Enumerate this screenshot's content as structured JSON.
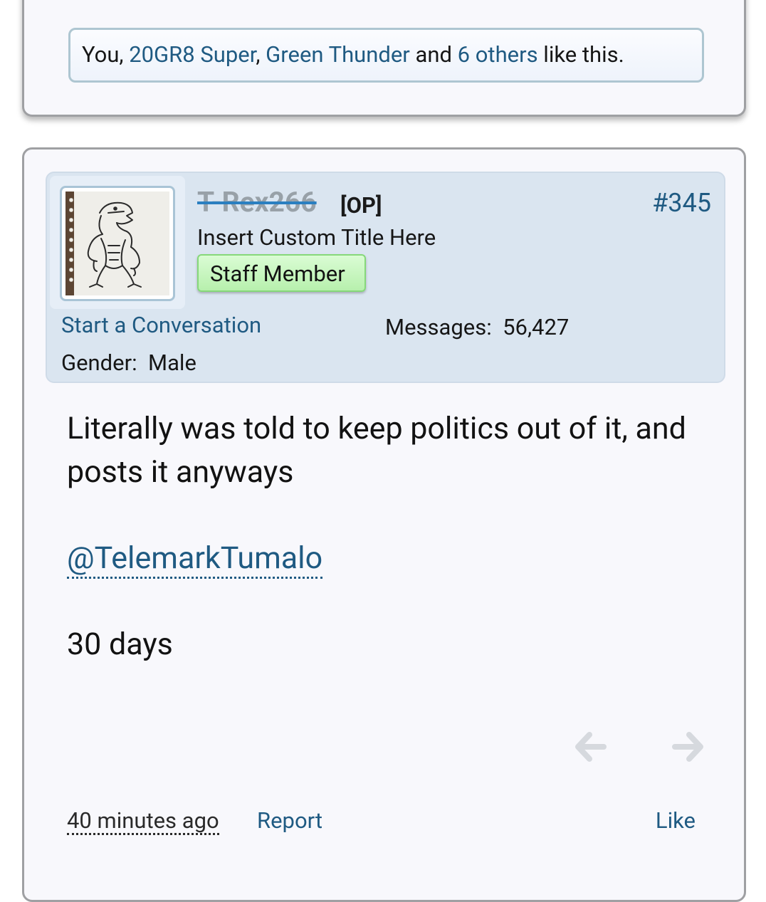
{
  "previous_post": {
    "likes": {
      "you": "You",
      "sep1": ", ",
      "user1": "20GR8 Super",
      "sep2": ", ",
      "user2": "Green Thunder",
      "and": " and ",
      "others": "6 others",
      "suffix": " like this."
    }
  },
  "post": {
    "username": "T-Rex266",
    "op_tag": "[OP]",
    "post_number": "#345",
    "user_title": "Insert Custom Title Here",
    "badge": "Staff Member",
    "start_conversation": "Start a Conversation",
    "messages_label": "Messages:",
    "messages_value": "56,427",
    "gender_label": "Gender:",
    "gender_value": "Male",
    "body": "Literally was told to keep politics out of it, and posts it anyways",
    "mention": "@TelemarkTumalo",
    "extra_line": "30 days",
    "timestamp": "40 minutes ago",
    "report_label": "Report",
    "like_label": "Like",
    "avatar_icon": "t-rex-drawing-avatar",
    "prev_icon": "arrow-left-icon",
    "next_icon": "arrow-right-icon"
  },
  "colors": {
    "link": "#1f5a82",
    "panel": "#dae5f0",
    "badge": "#b7f0ad"
  }
}
